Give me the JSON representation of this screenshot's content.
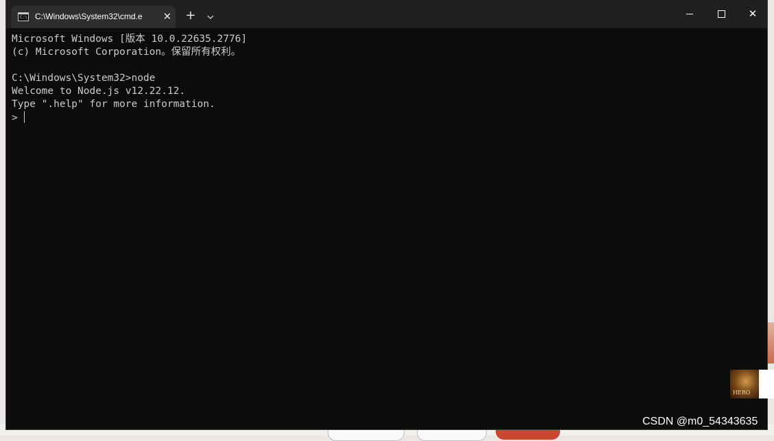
{
  "window": {
    "tab_title": "C:\\Windows\\System32\\cmd.e",
    "tab_icon_text": "C:\\",
    "tab_close": "✕",
    "new_tab": "+",
    "dropdown": "⌄",
    "close_glyph": "✕"
  },
  "terminal": {
    "lines": [
      "Microsoft Windows [版本 10.0.22635.2776]",
      "(c) Microsoft Corporation。保留所有权利。",
      "",
      "C:\\Windows\\System32>node",
      "Welcome to Node.js v12.22.12.",
      "Type \".help\" for more information.",
      "> "
    ]
  },
  "overlay": {
    "avatar_text": "HERO",
    "watermark": "CSDN @m0_54343635"
  },
  "icons": {
    "tab_icon": "cmd-icon",
    "tab_close": "close-icon",
    "new_tab": "plus-icon",
    "dropdown": "chevron-down-icon",
    "minimize": "minimize-icon",
    "maximize": "maximize-icon",
    "close": "close-icon"
  },
  "colors": {
    "terminal_bg": "#0c0c0c",
    "terminal_text": "#cccccc",
    "titlebar": "#202020",
    "tab_active": "#2e2e2e"
  }
}
